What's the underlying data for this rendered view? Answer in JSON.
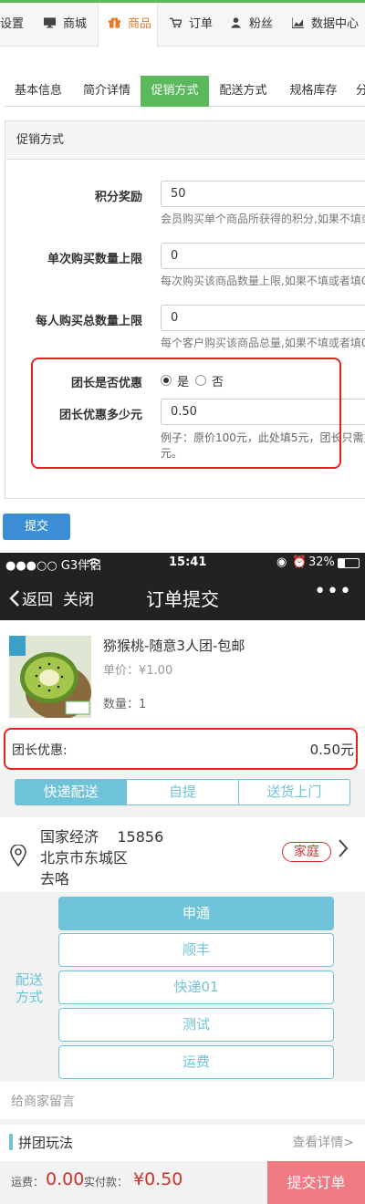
{
  "topnav": {
    "items": [
      {
        "label": "设置",
        "icon": ""
      },
      {
        "label": "商城",
        "icon": "monitor-icon"
      },
      {
        "label": "商品",
        "icon": "gift-icon"
      },
      {
        "label": "订单",
        "icon": "cart-icon"
      },
      {
        "label": "粉丝",
        "icon": "user-icon"
      },
      {
        "label": "数据中心",
        "icon": "chart-icon"
      }
    ],
    "active_index": 2,
    "active_color": "#e77b2c"
  },
  "tabs": [
    "基本信息",
    "简介详情",
    "促销方式",
    "配送方式",
    "规格库存",
    "分"
  ],
  "active_tab_color": "#5bb85d",
  "panel": {
    "title": "促销方式",
    "fields": [
      {
        "label": "积分奖励",
        "value": "50",
        "help": "会员购买单个商品所获得的积分,如果不填或"
      },
      {
        "label": "单次购买数量上限",
        "value": "0",
        "help": "每次购买该商品数量上限,如果不填或者填0"
      },
      {
        "label": "每人购买总数量上限",
        "value": "0",
        "help": "每个客户购买该商品总量,如果不填或者填0"
      }
    ],
    "leader_discount": {
      "label": "团长是否优惠",
      "yes": "是",
      "no": "否",
      "selected": "是"
    },
    "leader_amount": {
      "label": "团长优惠多少元",
      "value": "0.50",
      "help_line1": "例子：原价100元，此处填5元，团长只需支",
      "help_line2": "元。"
    }
  },
  "submit_label": "提交",
  "mobile": {
    "status": {
      "carrier": "●●●○○ G3伴侣",
      "time": "15:41",
      "battery": "32%"
    },
    "nav": {
      "back": "返回",
      "close": "关闭",
      "title": "订单提交",
      "more": "•••"
    },
    "product": {
      "name": "猕猴桃-随意3人团-包邮",
      "price": "单价：¥1.00",
      "qty": "数量：1",
      "img_label_top": "产地\n直采",
      "img_label_bottom": "热销进口果品"
    },
    "discount": {
      "label": "团长优惠:",
      "value": "0.50元"
    },
    "delivery_tabs": [
      "快递配送",
      "自提",
      "送货上门"
    ],
    "address": {
      "name": "国家经济",
      "phone": "15856",
      "line1": "北京市东城区",
      "line2": "去咯",
      "tag": "家庭"
    },
    "shipping": {
      "label": "配送方式",
      "options": [
        "申通",
        "顺丰",
        "快递01",
        "测试",
        "运费"
      ],
      "selected_index": 0
    },
    "message_placeholder": "给商家留言",
    "pintuan": {
      "title": "拼团玩法",
      "more": "查看详情>"
    },
    "footer": {
      "freight_label": "运费：",
      "freight_value": "0.00",
      "pay_label": "实付款：",
      "pay_value": "¥0.50",
      "submit": "提交订单"
    },
    "accent": "#6fc3d8",
    "price_color": "#d0332c"
  }
}
